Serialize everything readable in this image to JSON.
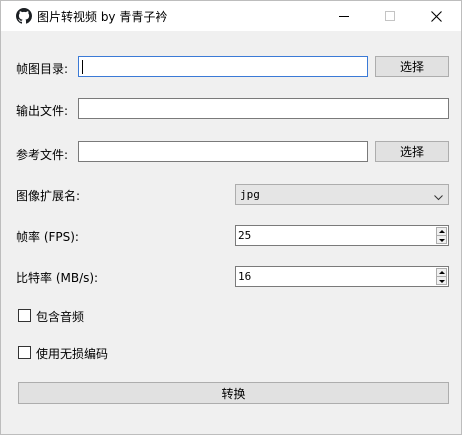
{
  "window": {
    "title": "图片转视频 by 青青子衿",
    "minimize": "—",
    "maximize": "□",
    "close": "✕"
  },
  "frames_dir": {
    "label": "帧图目录:",
    "value": "",
    "button": "选择"
  },
  "output_file": {
    "label": "输出文件:",
    "value": ""
  },
  "reference_file": {
    "label": "参考文件:",
    "value": "",
    "button": "选择"
  },
  "image_ext": {
    "label": "图像扩展名:",
    "value": "jpg"
  },
  "fps": {
    "label": "帧率 (FPS):",
    "value": "25"
  },
  "bitrate": {
    "label": "比特率 (MB/s):",
    "value": "16"
  },
  "include_audio": {
    "label": "包含音频",
    "checked": false
  },
  "lossless": {
    "label": "使用无损编码",
    "checked": false
  },
  "convert_button": "转换"
}
